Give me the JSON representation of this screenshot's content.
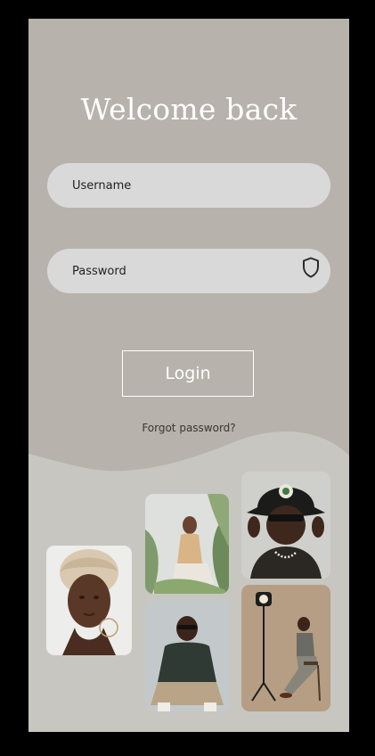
{
  "header": {
    "title": "Welcome back"
  },
  "form": {
    "username_placeholder": "Username",
    "password_placeholder": "Password",
    "login_label": "Login",
    "forgot_label": "Forgot password?"
  },
  "icons": {
    "password_toggle": "shield-icon"
  },
  "colors": {
    "top_background": "#b7b2ab",
    "bottom_background": "#c8c6c0",
    "field_background": "#d9d9d9",
    "text_light": "#ffffff"
  },
  "gallery": [
    {
      "subject": "portrait-headwrap"
    },
    {
      "subject": "woman-with-plants"
    },
    {
      "subject": "man-sitting"
    },
    {
      "subject": "man-bucket-hat"
    },
    {
      "subject": "woman-studio-light"
    }
  ]
}
